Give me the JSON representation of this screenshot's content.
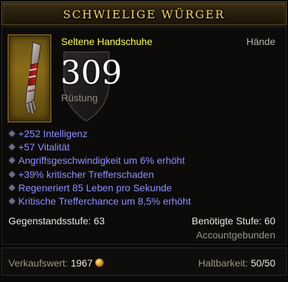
{
  "header": {
    "title": "SCHWIELIGE WÜRGER"
  },
  "item": {
    "rarity_type": "Seltene Handschuhe",
    "slot": "Hände",
    "armor_value": "309",
    "armor_label": "Rüstung",
    "icon": "gauntlet-icon"
  },
  "stats": [
    "+252 Intelligenz",
    "+57 Vitalität",
    "Angriffsgeschwindigkeit um 6% erhöht",
    "+39% kritischer Trefferschaden",
    "Regeneriert 85 Leben pro Sekunde",
    "Kritische Trefferchance um 8,5% erhöht"
  ],
  "info": {
    "item_level": "Gegenstandsstufe: 63",
    "required_level": "Benötigte Stufe: 60",
    "bound": "Accountgebunden"
  },
  "footer": {
    "sell_label": "Verkaufswert:",
    "sell_value": "1967",
    "durability_label": "Haltbarkeit:",
    "durability_value": "50/50"
  },
  "colors": {
    "title": "#f0d470",
    "rare": "#ffff4c",
    "magic_stat": "#8e8eff",
    "text": "#eae6de",
    "muted": "#9a958c"
  }
}
